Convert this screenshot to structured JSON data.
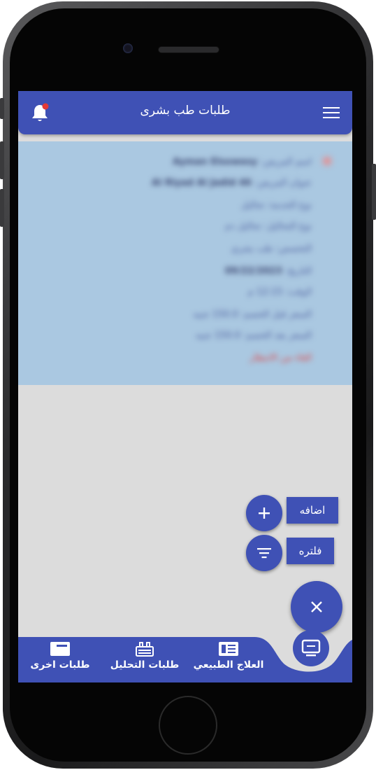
{
  "app": {
    "title": "طلبات طب بشرى"
  },
  "card": {
    "lines": [
      {
        "label": "اسم المريض:",
        "value": "Ayman Elsowesy"
      },
      {
        "label": "عنوان المريض:",
        "value": "Al Riyad Al Jadid 46"
      },
      {
        "label": "نوع الخدمة: تحاليل",
        "value": ""
      },
      {
        "label": "نوع التحاليل: تحاليل دم",
        "value": ""
      },
      {
        "label": "التخصص: طب بشري",
        "value": ""
      },
      {
        "label": "التاريخ:",
        "value": "09/22/2023"
      },
      {
        "label": "الوقت: 12:15 م",
        "value": ""
      },
      {
        "label": "السعر قبل الخصم: 150.0 جنيه",
        "value": ""
      },
      {
        "label": "السعر بعد الخصم: 150.0 جنيه",
        "value": ""
      },
      {
        "label": "الغاء من الانتظار",
        "value": ""
      }
    ]
  },
  "fabs": {
    "add_label": "اضافه",
    "filter_label": "فلتره",
    "close_symbol": "×"
  },
  "bottom_nav": {
    "items": [
      {
        "label": "العلاج الطبيعي",
        "icon": "document-icon"
      },
      {
        "label": "طلبات التحليل",
        "icon": "lab-icon"
      },
      {
        "label": "طلبات اخرى",
        "icon": "card-icon"
      }
    ],
    "center_icon": "monitor-icon"
  },
  "colors": {
    "primary": "#3f51b5",
    "card_bg": "#aac8e1",
    "screen_bg": "#dcdcdc",
    "notification_dot": "#e53935",
    "cancel_text": "#e23c3c"
  }
}
